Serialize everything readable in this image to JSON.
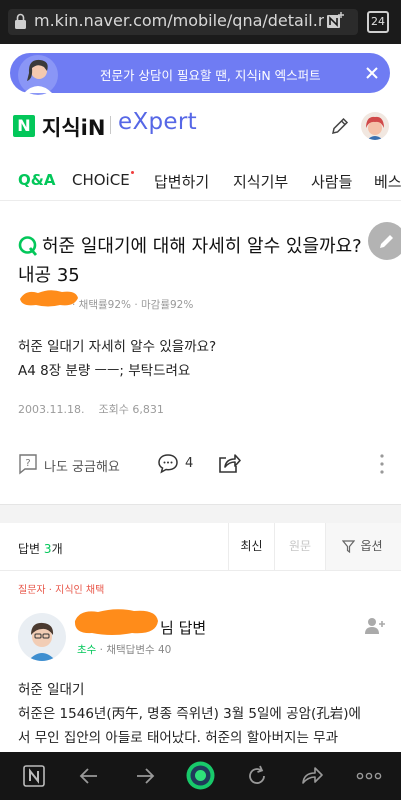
{
  "browser": {
    "url": "m.kin.naver.com/mobile/qna/detail.nhn",
    "tab_count": "24"
  },
  "banner": {
    "text": "전문가 상담이 필요할 땐, 지식iN 엑스퍼트"
  },
  "header": {
    "logo_n": "N",
    "logo_kin": "지식iN",
    "logo_expert": "eXpert"
  },
  "tabs": [
    {
      "label": "Q&A",
      "active": true
    },
    {
      "label": "CHOiCE",
      "active": false
    },
    {
      "label": "답변하기",
      "active": false
    },
    {
      "label": "지식기부",
      "active": false
    },
    {
      "label": "사람들",
      "active": false
    },
    {
      "label": "베스",
      "active": false
    }
  ],
  "question": {
    "title": "허준 일대기에 대해 자세히 알수 있을까요? 내공 35",
    "stats": "· 채택률92% · 마감률92%",
    "body": [
      "허준 일대기 자세히 알수 있을까요?",
      "A4 8장 분량 ㅡㅡ; 부탁드려요"
    ],
    "date": "2003.11.18.",
    "views": "조회수 6,831",
    "curious_label": "나도 궁금해요",
    "comment_count": "4"
  },
  "answers": {
    "label": "답변",
    "count": "3",
    "count_suffix": "개",
    "sort_recent": "최신",
    "sort_original": "원문",
    "options_label": "옵션"
  },
  "answer": {
    "tag": "질문자 · 지식인 채택",
    "title": "님 답변",
    "grade": "초수",
    "adopted": " · 채택답변수 40",
    "body": [
      "허준 일대기",
      "허준은 1546년(丙午, 명종 즉위년) 3월 5일에 공암(孔岩)에",
      "서 무인 집안의 아들로 태어났다. 허준의 할아버지는 무과"
    ]
  },
  "colors": {
    "naver_green": "#03c75a",
    "banner_purple": "#6f7cf3",
    "expert_blue": "#5667e6"
  }
}
